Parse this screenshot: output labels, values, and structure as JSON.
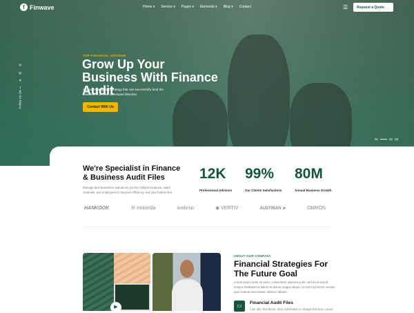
{
  "brand": {
    "name": "Finwave"
  },
  "nav": {
    "items": [
      "Home",
      "Service",
      "Pages",
      "Elements",
      "Blog",
      "Contact"
    ],
    "cta": "Request a Quote"
  },
  "hero": {
    "eyebrow": "TOP FINANCIAL ADVISOR",
    "title": "Grow Up Your Business With Finance Audit",
    "subtitle": "A good strategy is a strategy that can successfully lead the business in a more developed direction.",
    "button": "Contact With Us",
    "follow": "Follow Us On",
    "pager": [
      "01",
      "02",
      "03"
    ]
  },
  "specialist": {
    "title": "We're Specialist in Finance & Business Audit Files",
    "description": "Manage and streamline operations across multiple locations, sales channels, and employees to improve efficiency and your bottom line.",
    "stats": [
      {
        "value": "12K",
        "label": "Professional Advisors"
      },
      {
        "value": "99%",
        "label": "Our Clients Satisfactions"
      },
      {
        "value": "80M",
        "label": "Annual Business Growth"
      }
    ],
    "logos": [
      "HANKOOK",
      "motorola",
      "sodexo",
      "VERTIV",
      "AUSTRIAN",
      "OMRON"
    ]
  },
  "about": {
    "eyebrow": "ABOUT OUR COMPANY",
    "title": "Financial Strategies For The Future Goal",
    "text": "Lorem ipsum dolor sit amet, consectetur adipiscing elit, sed do eiusmod tempor incididunt ut labore et dolore magna aliqua. Ut enim ad minim veniam, quis nostrud exercitation ullamco laboris.",
    "feature_title": "Financial Audit Files",
    "feature_text": "I am Info Text block. Click edit button to change this text. Lorem"
  },
  "colors": {
    "primary": "#14553c",
    "accent": "#f5b400"
  }
}
